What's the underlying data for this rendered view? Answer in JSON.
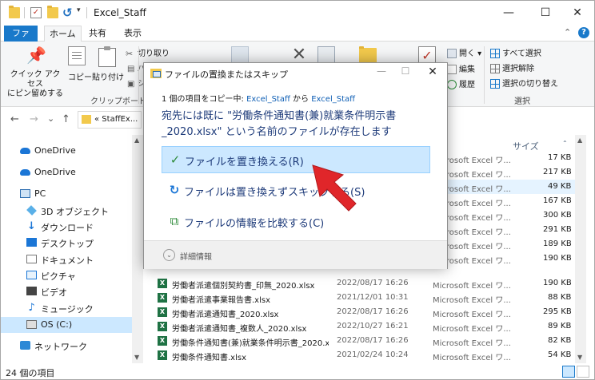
{
  "window": {
    "title": "Excel_Staff",
    "controls": {
      "minimize": "—",
      "maximize": "☐",
      "close": "✕"
    }
  },
  "ribbon_tabs": {
    "file": "ファイル",
    "home": "ホーム",
    "share": "共有",
    "view": "表示"
  },
  "ribbon": {
    "pin_quick_access": "クイック アクセス\nにピン留めする",
    "copy": "コピー",
    "paste": "貼り付け",
    "cut": "切り取り",
    "group_clipboard": "クリップボード",
    "open": "開く",
    "edit": "編集",
    "history": "履歴",
    "select_all": "すべて選択",
    "select_none": "選択解除",
    "invert_selection": "選択の切り替え",
    "group_select": "選択"
  },
  "address": {
    "path": "« StaffEx...",
    "nav_back": "←",
    "nav_forward": "→",
    "nav_dropdown": "⌄",
    "nav_up": "↑"
  },
  "nav": {
    "items": [
      {
        "label": "OneDrive",
        "icon": "onedrive-icon"
      },
      {
        "label": "OneDrive",
        "icon": "onedrive-icon"
      },
      {
        "label": "PC",
        "icon": "pc-icon"
      },
      {
        "label": "3D オブジェクト",
        "icon": "3d-objects-icon"
      },
      {
        "label": "ダウンロード",
        "icon": "downloads-icon"
      },
      {
        "label": "デスクトップ",
        "icon": "desktop-icon"
      },
      {
        "label": "ドキュメント",
        "icon": "documents-icon"
      },
      {
        "label": "ピクチャ",
        "icon": "pictures-icon"
      },
      {
        "label": "ビデオ",
        "icon": "videos-icon"
      },
      {
        "label": "ミュージック",
        "icon": "music-icon"
      },
      {
        "label": "OS (C:)",
        "icon": "drive-icon"
      },
      {
        "label": "ネットワーク",
        "icon": "network-icon"
      }
    ]
  },
  "filelist": {
    "col_size": "サイズ",
    "upper_rows": [
      {
        "type": "Microsoft Excel ワ...",
        "size": "17 KB"
      },
      {
        "type": "Microsoft Excel ワ...",
        "size": "217 KB"
      },
      {
        "type": "Microsoft Excel ワ...",
        "size": "49 KB"
      },
      {
        "type": "Microsoft Excel ワ...",
        "size": "167 KB"
      },
      {
        "type": "Microsoft Excel ワ...",
        "size": "300 KB"
      },
      {
        "type": "Microsoft Excel ワ...",
        "size": "291 KB"
      },
      {
        "type": "Microsoft Excel ワ...",
        "size": "189 KB"
      },
      {
        "type": "Microsoft Excel ワ...",
        "size": "190 KB"
      }
    ],
    "rows": [
      {
        "name": "労働者派遣個別契約書_印無_2020.xlsx",
        "date": "2022/08/17 16:26",
        "type": "Microsoft Excel ワ...",
        "size": "190 KB"
      },
      {
        "name": "労働者派遣事業報告書.xlsx",
        "date": "2021/12/01 10:31",
        "type": "Microsoft Excel ワ...",
        "size": "88 KB"
      },
      {
        "name": "労働者派遣通知書_2020.xlsx",
        "date": "2022/08/17 16:26",
        "type": "Microsoft Excel ワ...",
        "size": "295 KB"
      },
      {
        "name": "労働者派遣通知書_複数人_2020.xlsx",
        "date": "2022/10/27 16:21",
        "type": "Microsoft Excel ワ...",
        "size": "89 KB"
      },
      {
        "name": "労働条件通知書(兼)就業条件明示書_2020.xlsx",
        "date": "2022/08/17 16:26",
        "type": "Microsoft Excel ワ...",
        "size": "82 KB"
      },
      {
        "name": "労働条件通知書.xlsx",
        "date": "2021/02/24 10:24",
        "type": "Microsoft Excel ワ...",
        "size": "54 KB"
      }
    ]
  },
  "status": {
    "count": "24 個の項目"
  },
  "dialog": {
    "title": "ファイルの置換またはスキップ",
    "copy_prefix": "1 個の項目をコピー中: ",
    "source": "Excel_Staff",
    "from": " から ",
    "dest": "Excel_Staff",
    "message": "宛先には既に \"労働条件通知書(兼)就業条件明示書_2020.xlsx\" という名前のファイルが存在します",
    "opt_replace": "ファイルを置き換える(R)",
    "opt_skip": "ファイルは置き換えずスキップする(S)",
    "opt_compare": "ファイルの情報を比較する(C)",
    "more_details": "詳細情報"
  },
  "colors": {
    "accent": "#1979ca",
    "dialog_text": "#1e3b7a",
    "arrow": "#e0262a"
  }
}
